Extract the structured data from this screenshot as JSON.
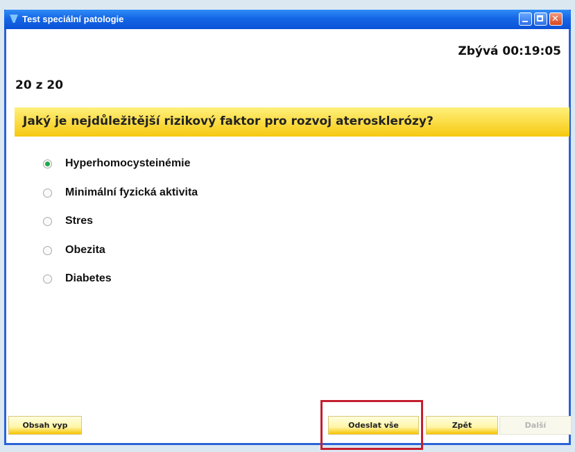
{
  "window": {
    "title": "Test speciální patologie"
  },
  "timer": {
    "text": "Zbývá 00:19:05"
  },
  "progress": {
    "text": "20 z 20"
  },
  "question": {
    "text": "Jaký je nejdůležitější rizikový faktor pro rozvoj aterosklerózy?"
  },
  "answers": [
    {
      "label": "Hyperhomocysteinémie",
      "selected": true
    },
    {
      "label": "Minimální fyzická aktivita",
      "selected": false
    },
    {
      "label": "Stres",
      "selected": false
    },
    {
      "label": "Obezita",
      "selected": false
    },
    {
      "label": "Diabetes",
      "selected": false
    }
  ],
  "buttons": {
    "contents": "Obsah vyp",
    "submit_all": "Odeslat vše",
    "back": "Zpět",
    "next": "Další"
  },
  "colors": {
    "titlebar": "#1566e6",
    "question_bg": "#f6c911",
    "selected_radio": "#1ea84a",
    "highlight": "#c41e2e"
  }
}
